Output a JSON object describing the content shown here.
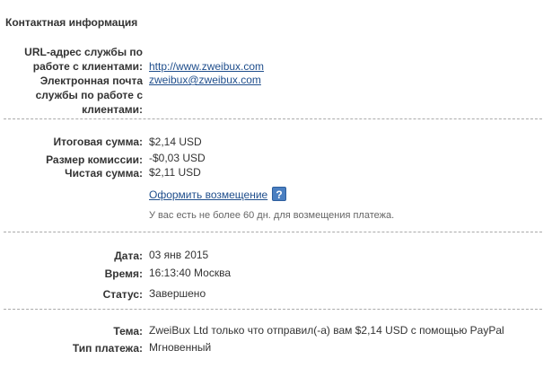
{
  "contact": {
    "title": "Контактная информация",
    "service_url_label": "URL-адрес службы по работе с клиентами:",
    "service_url": "http://www.zweibux.com",
    "email_label": "Электронная почта службы по работе с клиентами:",
    "email": "zweibux@zweibux.com"
  },
  "amounts": {
    "total_label": "Итоговая сумма:",
    "total": "$2,14 USD",
    "fee_label": "Размер комиссии:",
    "fee": "-$0,03 USD",
    "net_label": "Чистая сумма:",
    "net": "$2,11 USD",
    "refund_link": "Оформить возмещение",
    "help_icon": "?",
    "refund_note": "У вас есть не более 60 дн. для возмещения платежа."
  },
  "details": {
    "date_label": "Дата:",
    "date": "03 янв 2015",
    "time_label": "Время:",
    "time": "16:13:40 Москва",
    "status_label": "Статус:",
    "status": "Завершено"
  },
  "payment": {
    "subject_label": "Тема:",
    "subject": "ZweiBux Ltd только что отправил(-а) вам $2,14 USD с помощью PayPal",
    "type_label": "Тип платежа:",
    "type": "Мгновенный"
  },
  "colors": {
    "link": "#1f4e8c",
    "help_icon": "#4a7fc1",
    "divider": "#aaaaaa"
  }
}
